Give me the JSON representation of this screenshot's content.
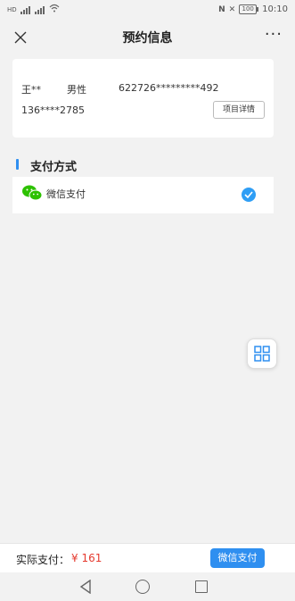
{
  "status_bar": {
    "time": "10:10",
    "battery": "100",
    "left_text": "HD",
    "right_icons": [
      "nfc-icon",
      "mute-icon",
      "battery-icon"
    ]
  },
  "nav": {
    "title": "预约信息",
    "close_icon": "close-icon",
    "more_label": "···"
  },
  "patient": {
    "name": "王**",
    "gender": "男性",
    "id_number": "622726*********492",
    "phone": "136****2785",
    "detail_button": "项目详情"
  },
  "payment": {
    "section_title": "支付方式",
    "method": "微信支付",
    "selected": true
  },
  "bottom": {
    "total_label": "实际支付：",
    "total_amount": "¥ 161",
    "pay_button": "微信支付"
  },
  "colors": {
    "accent": "#2f8ff0",
    "price": "#e53a2f",
    "wechat_green": "#2dc100"
  }
}
